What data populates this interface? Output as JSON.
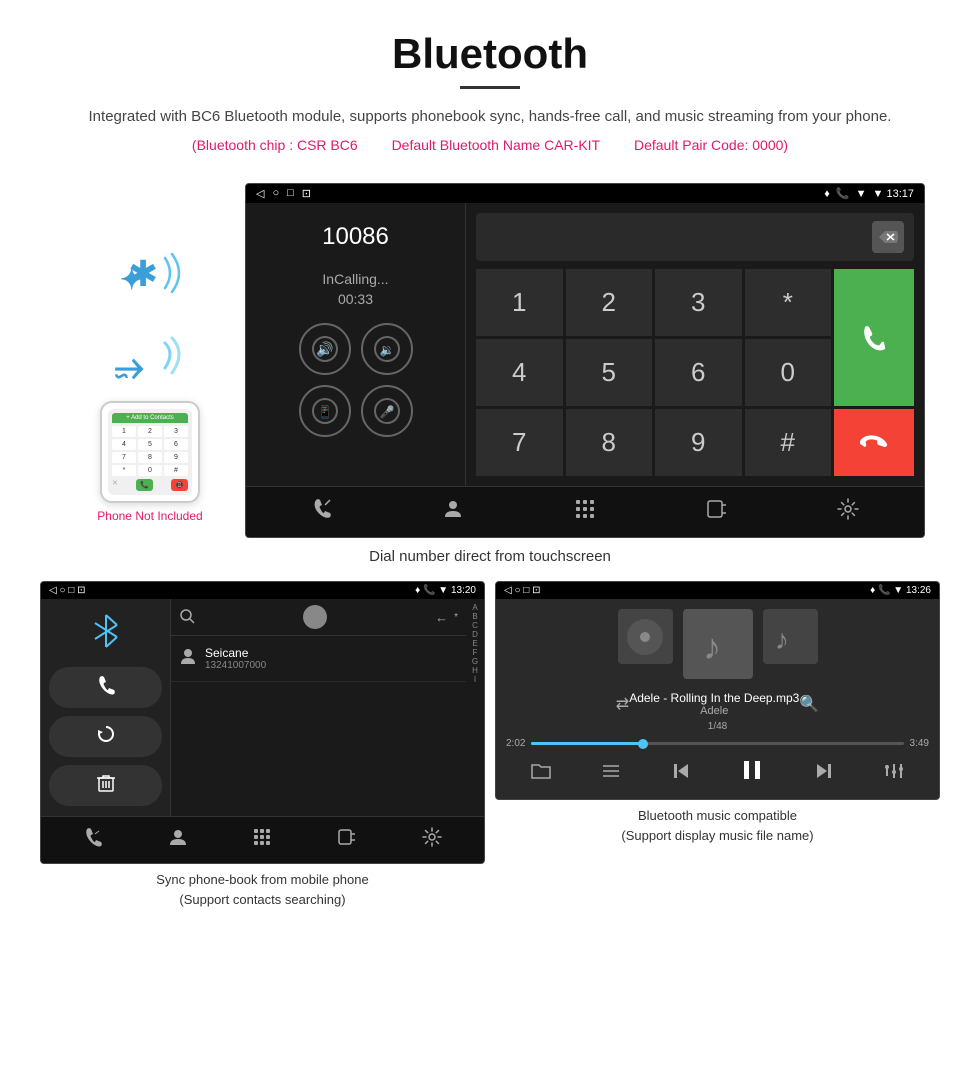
{
  "header": {
    "title": "Bluetooth",
    "underline": true,
    "description": "Integrated with BC6 Bluetooth module, supports phonebook sync, hands-free call, and music streaming from your phone.",
    "specs": [
      "(Bluetooth chip : CSR BC6",
      "Default Bluetooth Name CAR-KIT",
      "Default Pair Code: 0000)"
    ]
  },
  "phone_aside": {
    "not_included": "Phone Not Included"
  },
  "main_screen": {
    "status_bar": {
      "left": [
        "◁",
        "○",
        "□",
        "⊡"
      ],
      "right": [
        "♦",
        "📞",
        "▼ 13:17"
      ]
    },
    "dial_number": "10086",
    "in_calling": "InCalling...",
    "timer": "00:33",
    "numpad": {
      "rows": [
        [
          "1",
          "2",
          "3",
          "*"
        ],
        [
          "4",
          "5",
          "6",
          "0"
        ],
        [
          "7",
          "8",
          "9",
          "#"
        ]
      ]
    },
    "call_green_icon": "📞",
    "call_red_icon": "📵"
  },
  "main_caption": "Dial number direct from touchscreen",
  "phonebook_screen": {
    "status_bar": {
      "time": "13:20",
      "left_icons": "⊡ ○ □ ⊡"
    },
    "contact": {
      "name": "Seicane",
      "number": "13241007000"
    },
    "alpha_list": [
      "A",
      "B",
      "C",
      "D",
      "E",
      "F",
      "G",
      "H",
      "I"
    ]
  },
  "phonebook_caption": {
    "line1": "Sync phone-book from mobile phone",
    "line2": "(Support contacts searching)"
  },
  "music_screen": {
    "status_bar": {
      "time": "13:26",
      "left_icons": "○ □ ⊡"
    },
    "song": "Adele - Rolling In the Deep.mp3",
    "artist": "Adele",
    "track_info": "1/48",
    "time_current": "2:02",
    "time_total": "3:49",
    "progress_percent": 30
  },
  "music_caption": {
    "line1": "Bluetooth music compatible",
    "line2": "(Support display music file name)"
  }
}
